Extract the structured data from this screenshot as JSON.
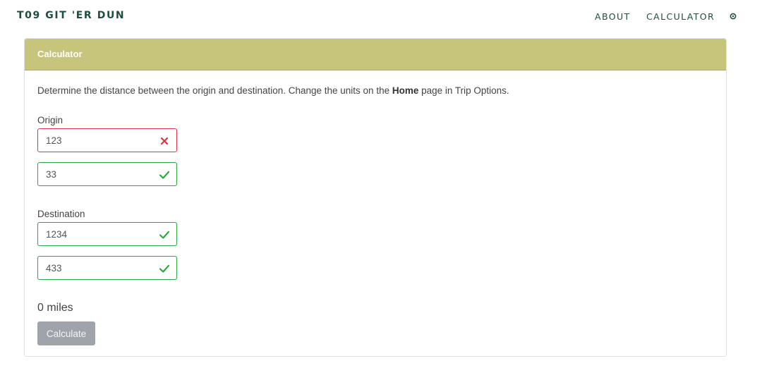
{
  "nav": {
    "brand": "T09 GIT 'ER DUN",
    "links": [
      "ABOUT",
      "CALCULATOR"
    ],
    "settings_icon": "gear-icon"
  },
  "calculator": {
    "title": "Calculator",
    "description_prefix": "Determine the distance between the origin and destination. Change the units on the ",
    "description_bold": "Home",
    "description_suffix": " page in Trip Options.",
    "origin_label": "Origin",
    "origin_fields": [
      {
        "value": "123",
        "state": "invalid"
      },
      {
        "value": "33",
        "state": "valid"
      }
    ],
    "destination_label": "Destination",
    "destination_fields": [
      {
        "value": "1234",
        "state": "valid"
      },
      {
        "value": "433",
        "state": "valid"
      }
    ],
    "distance_text": "0 miles",
    "button_label": "Calculate"
  },
  "colors": {
    "brand": "#1f4d3d",
    "header": "#c7c47b",
    "valid": "#28a745",
    "invalid": "#dc3545",
    "button": "#9ea4a9"
  }
}
